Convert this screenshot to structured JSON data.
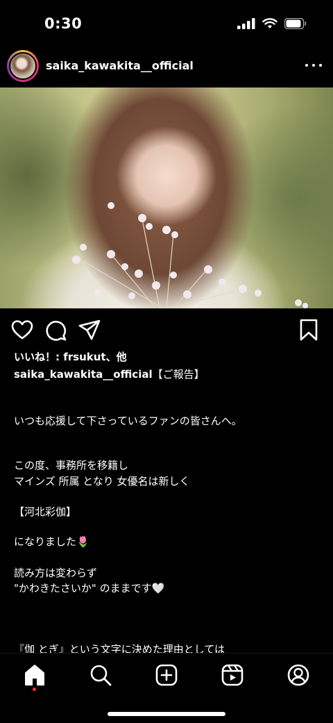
{
  "status_bar": {
    "time": "0:30"
  },
  "post": {
    "username": "saika_kawakita__official",
    "likes_text": "いいね！: frsukut、他",
    "caption_user": "saika_kawakita__official",
    "caption_first": "【ご報告】",
    "caption_lines": [
      "いつも応援して下さっているファンの皆さんへ。",
      "この度、事務所を移籍し",
      "マインズ 所属 となり 女優名は新しく",
      "【河北彩伽】",
      "になりました🌷",
      "読み方は変わらず",
      "\"かわきたさいか\" のままです🤍",
      "『伽 とぎ』という文字に決めた理由としては"
    ]
  },
  "icons": {
    "like": "heart-icon",
    "comment": "comment-icon",
    "share": "paper-plane-icon",
    "save": "bookmark-icon",
    "nav": [
      "home-icon",
      "search-icon",
      "create-icon",
      "reels-icon",
      "profile-icon"
    ]
  },
  "colors": {
    "background": "#000000",
    "text": "#ffffff",
    "notification_dot": "#ff3040"
  }
}
